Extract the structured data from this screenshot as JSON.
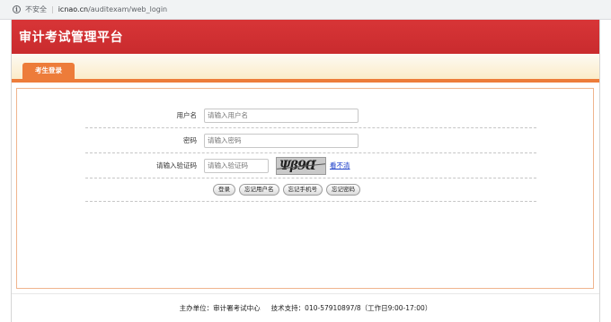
{
  "browser": {
    "security_label": "不安全",
    "url_host": "icnao.cn",
    "url_path": "/auditexam/web_login"
  },
  "header": {
    "title": "审计考试管理平台"
  },
  "tabs": [
    {
      "label": "考生登录"
    }
  ],
  "form": {
    "username": {
      "label": "用户名",
      "placeholder": "请输入用户名"
    },
    "password": {
      "label": "密码",
      "placeholder": "请输入密码"
    },
    "captcha": {
      "label": "请输入验证码",
      "placeholder": "请输入验证码",
      "image_text": "Ψβ9Ɑ",
      "refresh_label": "看不清"
    },
    "buttons": {
      "login": "登录",
      "forgot_username": "忘记用户名",
      "forgot_phone": "忘记手机号",
      "forgot_password": "忘记密码"
    }
  },
  "footer": {
    "organizer": "主办单位：审计署考试中心",
    "support": "技术支持：010-57910897/8（工作日9:00-17:00）"
  },
  "colors": {
    "header_red": "#d22f32",
    "accent_orange": "#ed7c3a",
    "link_blue": "#1b3ec9"
  }
}
